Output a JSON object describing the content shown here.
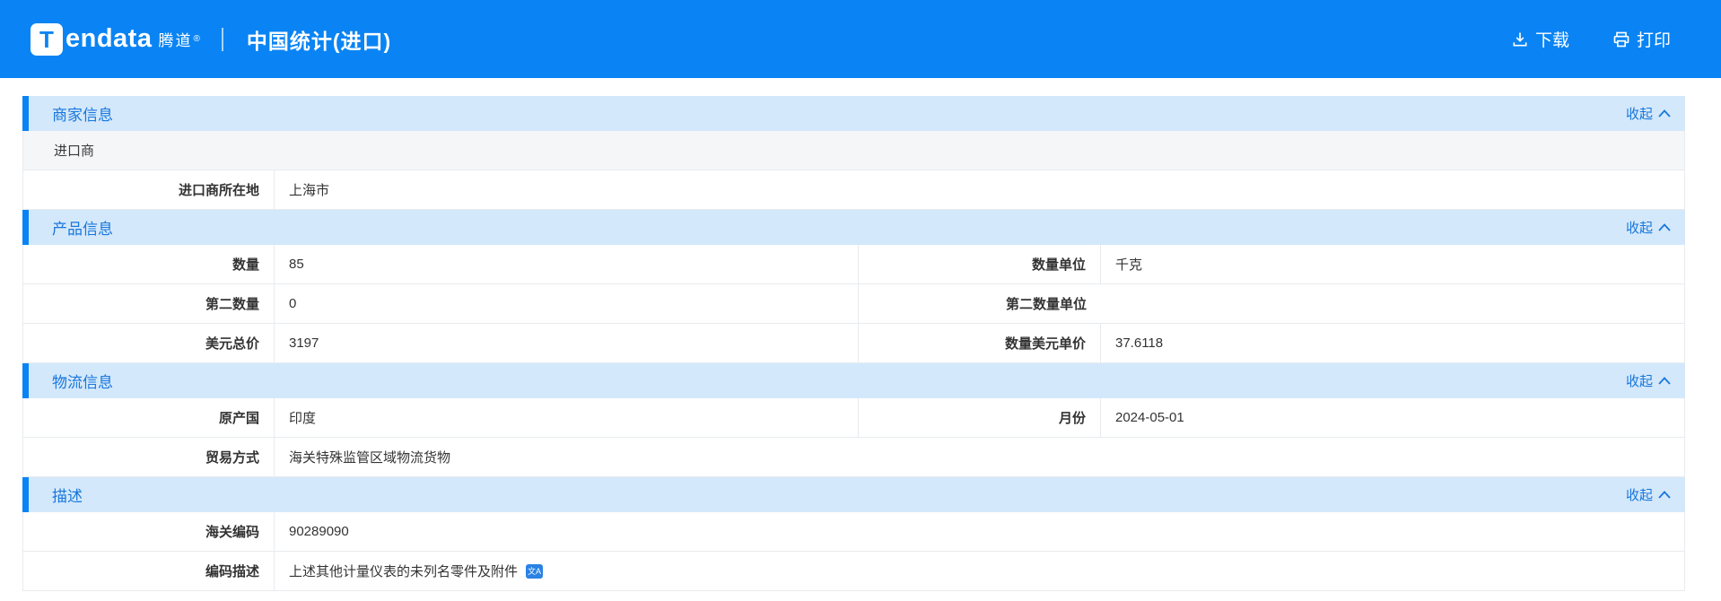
{
  "app": {
    "brand": {
      "icon_letter": "T",
      "wordmark": "endata",
      "cn_name": "腾道",
      "registered": "®"
    },
    "title": "中国统计(进口)",
    "actions": {
      "download": "下载",
      "print": "打印"
    }
  },
  "collapse": {
    "label": "收起"
  },
  "icons": {
    "translate_glyph": "文A"
  },
  "colors": {
    "brand_blue": "#0a84f4",
    "section_bg": "#d4e8fb",
    "section_text": "#1777dc"
  },
  "sections": [
    {
      "title": "商家信息",
      "full_row": "进口商",
      "rows": [
        {
          "label": "进口商所在地",
          "value": "上海市"
        }
      ]
    },
    {
      "title": "产品信息",
      "rows": [
        {
          "label": "数量",
          "value": "85",
          "label2": "数量单位",
          "value2": "千克"
        },
        {
          "label": "第二数量",
          "value": "0",
          "label2": "第二数量单位",
          "value2": ""
        },
        {
          "label": "美元总价",
          "value": "3197",
          "label2": "数量美元单价",
          "value2": "37.6118"
        }
      ]
    },
    {
      "title": "物流信息",
      "rows": [
        {
          "label": "原产国",
          "value": "印度",
          "label2": "月份",
          "value2": "2024-05-01"
        },
        {
          "label": "贸易方式",
          "value": "海关特殊监管区域物流货物"
        }
      ]
    },
    {
      "title": "描述",
      "rows": [
        {
          "label": "海关编码",
          "value": "90289090"
        },
        {
          "label": "编码描述",
          "value": "上述其他计量仪表的未列名零件及附件"
        }
      ]
    }
  ]
}
